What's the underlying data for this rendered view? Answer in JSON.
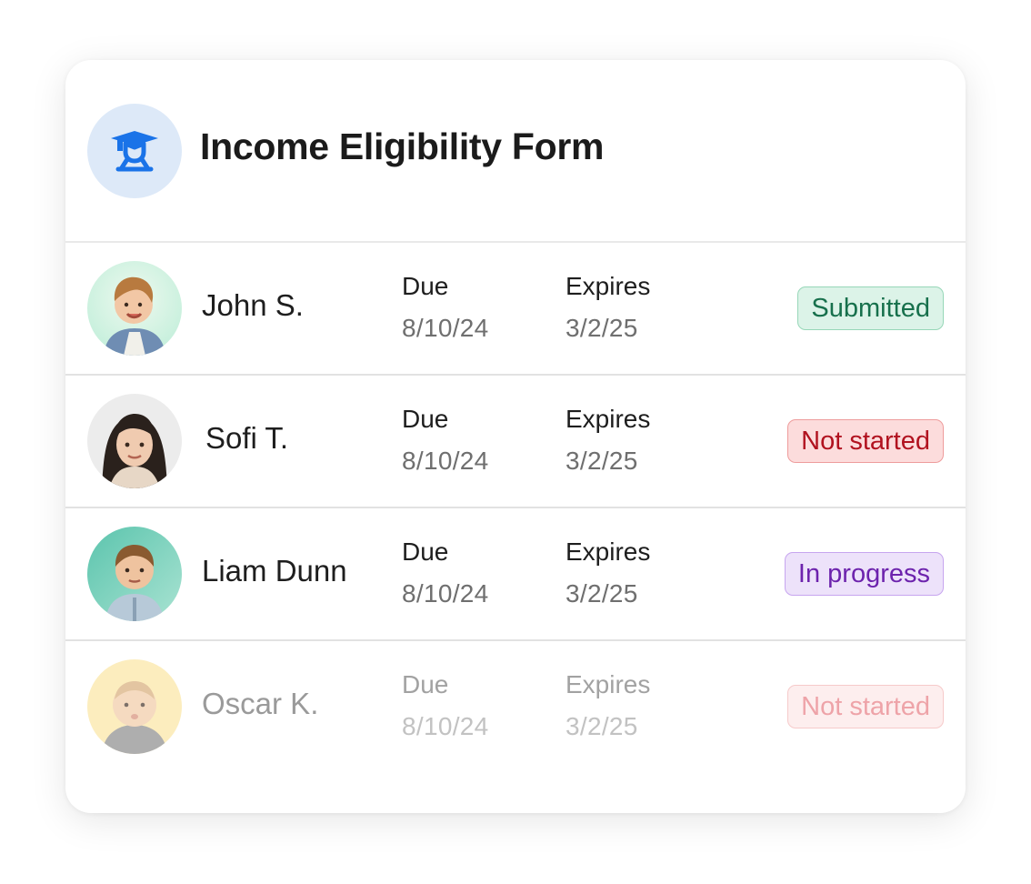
{
  "form": {
    "title": "Income Eligibility Form",
    "icon": "graduate-student-icon",
    "icon_color": "#1a73e8",
    "icon_bg": "#dde9f8"
  },
  "rows": [
    {
      "name": "John S.",
      "due_label": "Due",
      "due_date": "8/10/24",
      "expires_label": "Expires",
      "expires_date": "3/2/25",
      "status": "Submitted",
      "status_colors": {
        "text": "#17704c",
        "bg": "#dcf3e8",
        "border": "#97d7b8"
      }
    },
    {
      "name": "Sofi T.",
      "due_label": "Due",
      "due_date": "8/10/24",
      "expires_label": "Expires",
      "expires_date": "3/2/25",
      "status": "Not started",
      "status_colors": {
        "text": "#b1121f",
        "bg": "#fcdcdc",
        "border": "#ee9c9c"
      }
    },
    {
      "name": "Liam Dunn",
      "due_label": "Due",
      "due_date": "8/10/24",
      "expires_label": "Expires",
      "expires_date": "3/2/25",
      "status": "In progress",
      "status_colors": {
        "text": "#6d23ad",
        "bg": "#ede2fa",
        "border": "#c7a5ef"
      }
    },
    {
      "name": "Oscar K.",
      "due_label": "Due",
      "due_date": "8/10/24",
      "expires_label": "Expires",
      "expires_date": "3/2/25",
      "status": "Not started",
      "status_colors": {
        "text": "#eea3a8",
        "bg": "#fdeeee",
        "border": "#f6caca"
      }
    }
  ]
}
